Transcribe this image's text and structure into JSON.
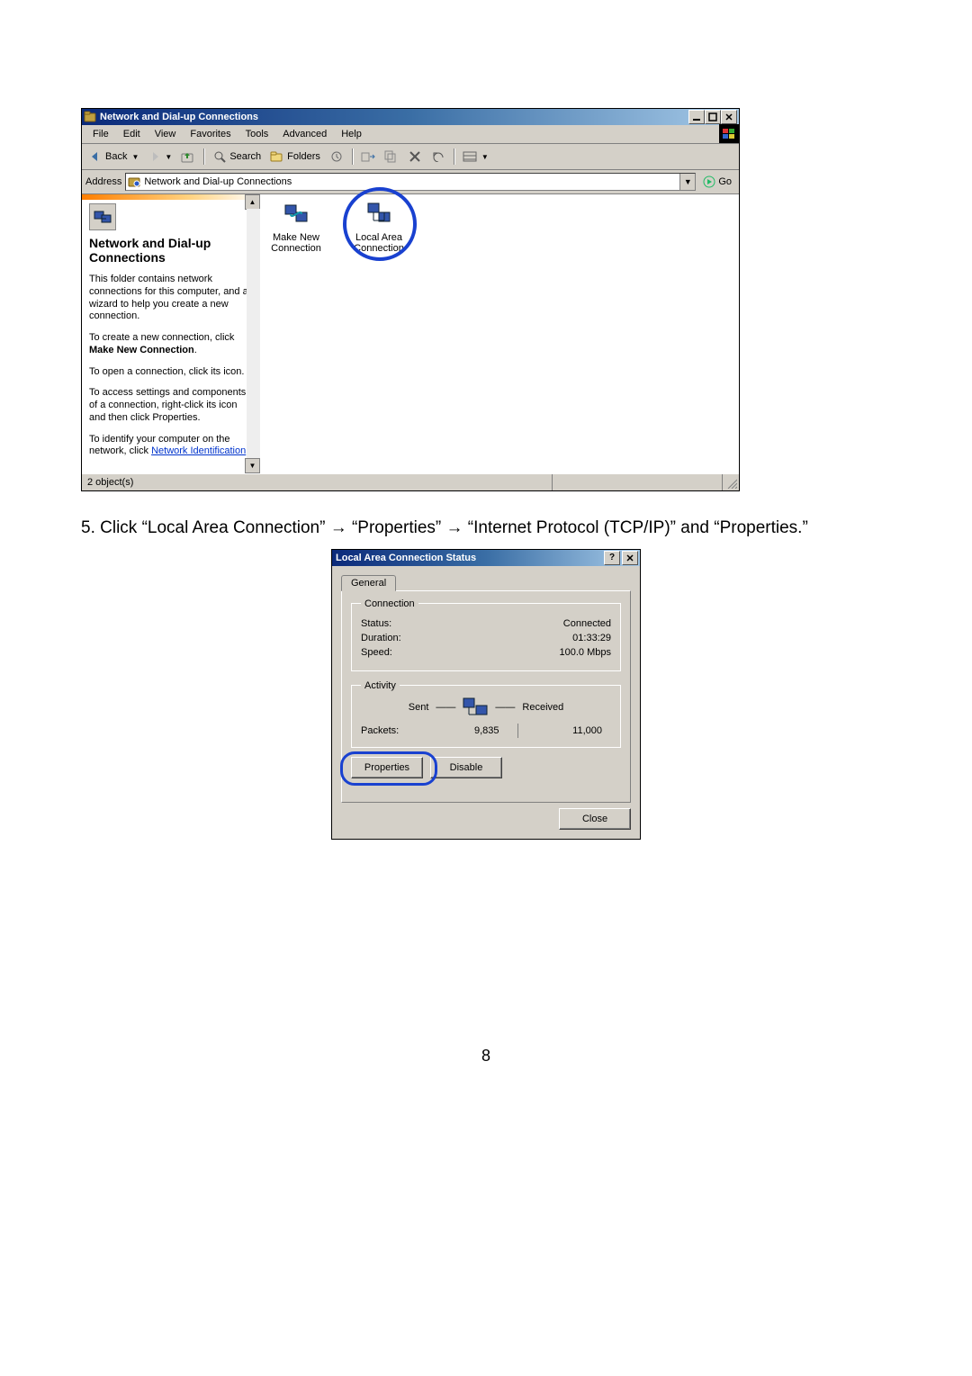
{
  "explorer": {
    "title": "Network and Dial-up Connections",
    "menu": [
      "File",
      "Edit",
      "View",
      "Favorites",
      "Tools",
      "Advanced",
      "Help"
    ],
    "toolbar": {
      "back_label": "Back",
      "search_label": "Search",
      "folders_label": "Folders"
    },
    "address_label": "Address",
    "address_value": "Network and Dial-up Connections",
    "go_label": "Go",
    "left": {
      "heading": "Network and Dial-up Connections",
      "p1": "This folder contains network connections for this computer, and a wizard to help you create a new connection.",
      "p2_a": "To create a new connection, click ",
      "p2_b": "Make New Connection",
      "p2_c": ".",
      "p3": "To open a connection, click its icon.",
      "p4": "To access settings and components of a connection, right-click its icon and then click Properties.",
      "p5_a": "To identify your computer on the network, click ",
      "p5_link": "Network Identification",
      "p5_c": "."
    },
    "icons": {
      "make_new": "Make New Connection",
      "lan": "Local Area Connection"
    },
    "status_objects": "2 object(s)"
  },
  "instruction": "5. Click “Local Area Connection” → “Properties” → “Internet Protocol (TCP/IP)” and “Properties.”",
  "dialog": {
    "title": "Local Area Connection Status",
    "tab_general": "General",
    "group_connection": "Connection",
    "status_label": "Status:",
    "status_value": "Connected",
    "duration_label": "Duration:",
    "duration_value": "01:33:29",
    "speed_label": "Speed:",
    "speed_value": "100.0 Mbps",
    "group_activity": "Activity",
    "sent_label": "Sent",
    "received_label": "Received",
    "packets_label": "Packets:",
    "packets_sent": "9,835",
    "packets_recv": "11,000",
    "btn_properties": "Properties",
    "btn_disable": "Disable",
    "btn_close": "Close"
  },
  "page_number": "8"
}
